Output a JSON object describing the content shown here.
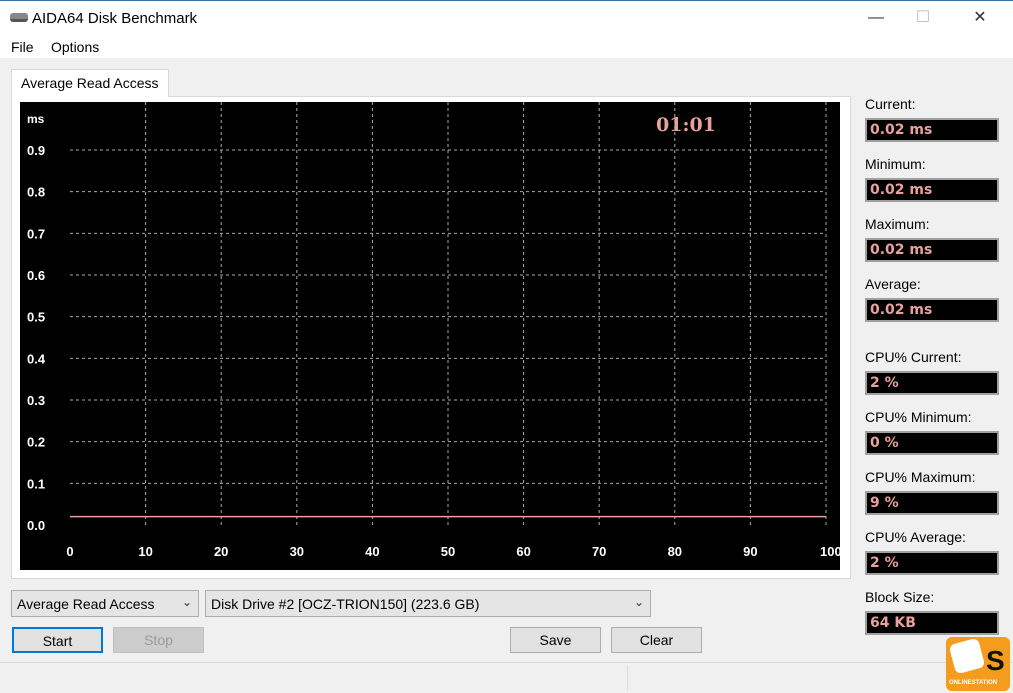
{
  "window": {
    "title": "AIDA64 Disk Benchmark",
    "minimize": "—",
    "maximize": "☐",
    "close": "✕"
  },
  "menu": {
    "file": "File",
    "options": "Options"
  },
  "tab": {
    "label": "Average Read Access"
  },
  "chart_data": {
    "type": "line",
    "title": "Average Read Access",
    "ylabel": "ms",
    "xlabel": "",
    "ylim": [
      0,
      0.9
    ],
    "xlim": [
      0,
      100
    ],
    "yticks": [
      "0.0",
      "0.1",
      "0.2",
      "0.3",
      "0.4",
      "0.5",
      "0.6",
      "0.7",
      "0.8",
      "0.9"
    ],
    "xticks": [
      "0",
      "10",
      "20",
      "30",
      "40",
      "50",
      "60",
      "70",
      "80",
      "90",
      "100 %"
    ],
    "grid": true,
    "series": [
      {
        "name": "Average Read Access",
        "x": [
          0,
          100
        ],
        "y": [
          0.02,
          0.02
        ],
        "color": "#e7a19a"
      }
    ],
    "timer": "01:01"
  },
  "stats": [
    {
      "label": "Current:",
      "value": "0.02 ms"
    },
    {
      "label": "Minimum:",
      "value": "0.02 ms"
    },
    {
      "label": "Maximum:",
      "value": "0.02 ms"
    },
    {
      "label": "Average:",
      "value": "0.02 ms"
    },
    {
      "label": "CPU% Current:",
      "value": "2 %"
    },
    {
      "label": "CPU% Minimum:",
      "value": "0 %"
    },
    {
      "label": "CPU% Maximum:",
      "value": "9 %"
    },
    {
      "label": "CPU% Average:",
      "value": "2 %"
    },
    {
      "label": "Block Size:",
      "value": "64 KB"
    }
  ],
  "controls": {
    "test_select": "Average Read Access",
    "drive_select": "Disk Drive #2  [OCZ-TRION150]  (223.6 GB)",
    "start": "Start",
    "stop": "Stop",
    "save": "Save",
    "clear": "Clear"
  },
  "watermark": {
    "text": "ONLINESTATION",
    "letter": "S"
  }
}
